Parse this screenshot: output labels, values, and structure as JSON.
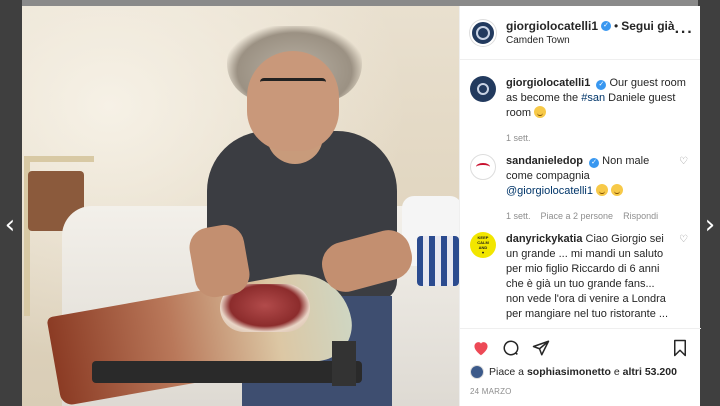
{
  "post": {
    "username": "giorgiolocatelli1",
    "follow_status": "Segui già",
    "separator": "•",
    "location": "Camden Town",
    "more_icon": "more-options-icon"
  },
  "comments": [
    {
      "username": "giorgiolocatelli1",
      "verified": true,
      "text_before": "Our guest room as become the ",
      "hashtag": "#san",
      "text_after": " Daniele guest room",
      "time": "1 sett."
    },
    {
      "username": "sandanieledop",
      "verified": true,
      "text_before": "Non male come compagnia ",
      "mention": "@giorgiolocatelli1",
      "time": "1 sett.",
      "likes": "Piace a 2 persone",
      "reply": "Rispondi"
    },
    {
      "username": "danyrickykatia",
      "verified": false,
      "text": "Ciao Giorgio sei un grande ... mi mandi un saluto per mio figlio Riccardo di 6 anni che è già un tuo grande fans... non vede l'ora di venire a Londra per mangiare nel tuo ristorante ... ciao grazie"
    }
  ],
  "likes": {
    "prefix": "Piace a ",
    "user": "sophiasimonetto",
    "middle": " e ",
    "others": "altri 53.200"
  },
  "date": "24 MARZO",
  "icons": {
    "like": "heart-icon",
    "comment": "comment-icon",
    "share": "share-icon",
    "save": "bookmark-icon"
  },
  "colors": {
    "like_heart": "#ed4956",
    "verified": "#3897f0",
    "link": "#003569"
  }
}
